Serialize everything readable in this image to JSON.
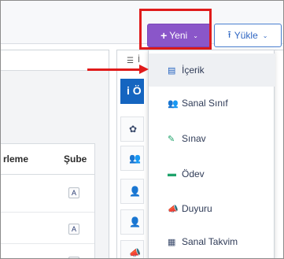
{
  "toolbar": {
    "new_button": {
      "icon": "plus-icon",
      "glyph": "+",
      "label": "Yeni",
      "caret": "⌄",
      "color": "#8a56c9"
    },
    "upload_button": {
      "icon": "upload-icon",
      "glyph": "⭱",
      "label": "Yükle",
      "caret": "⌄",
      "color": "#2f66c2"
    }
  },
  "annotation": {
    "highlight_color": "#e01b1b",
    "arrow_color": "#e01b1b"
  },
  "new_menu": {
    "items": [
      {
        "icon": "content-icon",
        "glyph": "▤",
        "label": "İçerik",
        "color": "#1f5fbf",
        "active": true
      },
      {
        "icon": "users-icon",
        "glyph": "👥",
        "label": "Sanal Sınıf",
        "color": "#1f6fd1"
      },
      {
        "icon": "edit-icon",
        "glyph": "✎",
        "label": "Sınav",
        "color": "#1fa36b"
      },
      {
        "icon": "briefcase-icon",
        "glyph": "▬",
        "label": "Ödev",
        "color": "#1fa36b"
      },
      {
        "icon": "megaphone-icon",
        "glyph": "📣",
        "label": "Duyuru",
        "color": "#3a4a6b"
      },
      {
        "icon": "calendar-icon",
        "glyph": "▦",
        "label": "Sanal Takvim",
        "color": "#3a4a6b"
      }
    ]
  },
  "table": {
    "headers": [
      "rleme",
      "Şube"
    ],
    "rows": [
      {
        "badge": "A"
      },
      {
        "badge": "A"
      },
      {
        "badge": "A"
      }
    ]
  },
  "side_panel": {
    "header_icon": "list-icon",
    "header_glyph": "☰",
    "header_text": "İ",
    "active_label": "i Ö",
    "active_color": "#1565c0",
    "rows": [
      {
        "icon": "gear-icon",
        "glyph": "✿"
      },
      {
        "icon": "users-icon",
        "glyph": "👥"
      },
      {
        "icon": "user-edit-icon",
        "glyph": "👤"
      },
      {
        "icon": "user-icon",
        "glyph": "👤"
      },
      {
        "icon": "megaphone-icon",
        "glyph": "📣"
      }
    ]
  }
}
